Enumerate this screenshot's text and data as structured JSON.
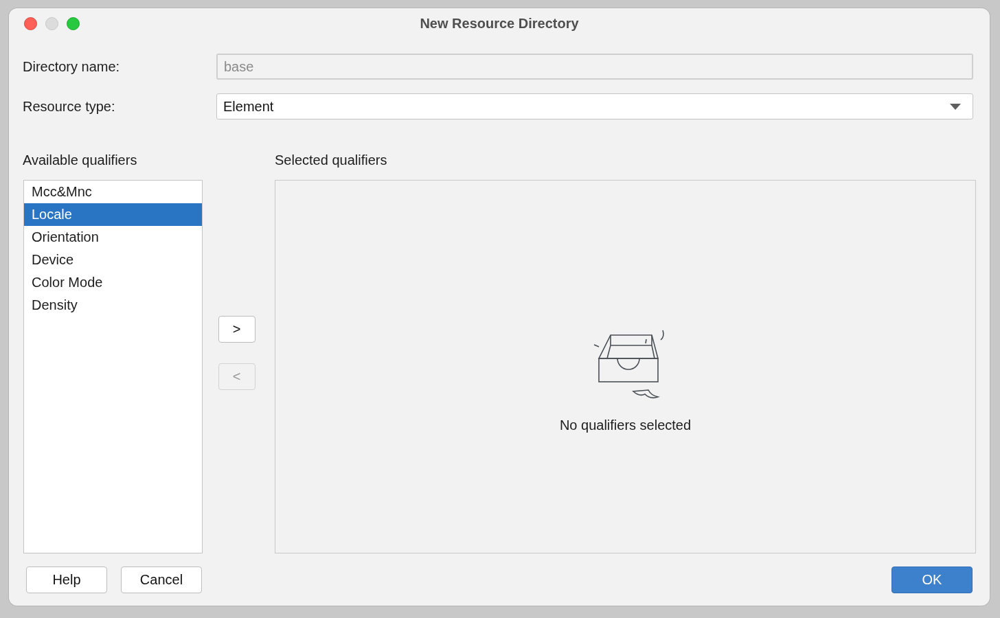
{
  "window": {
    "title": "New Resource Directory"
  },
  "directory_name": {
    "label": "Directory name:",
    "value": "base",
    "disabled": true
  },
  "resource_type": {
    "label": "Resource type:",
    "value": "Element"
  },
  "available_qualifiers": {
    "heading": "Available qualifiers",
    "items": [
      {
        "label": "Mcc&Mnc",
        "selected": false
      },
      {
        "label": "Locale",
        "selected": true
      },
      {
        "label": "Orientation",
        "selected": false
      },
      {
        "label": "Device",
        "selected": false
      },
      {
        "label": "Color Mode",
        "selected": false
      },
      {
        "label": "Density",
        "selected": false
      }
    ]
  },
  "move_buttons": [
    {
      "label": ">",
      "disabled": false
    },
    {
      "label": "<",
      "disabled": true
    }
  ],
  "selected_qualifiers": {
    "heading": "Selected qualifiers",
    "empty_text": "No qualifiers selected"
  },
  "buttons": [
    {
      "label": "Help",
      "kind": "plain"
    },
    {
      "label": "Cancel",
      "kind": "plain"
    },
    {
      "label": "OK",
      "kind": "default"
    }
  ]
}
